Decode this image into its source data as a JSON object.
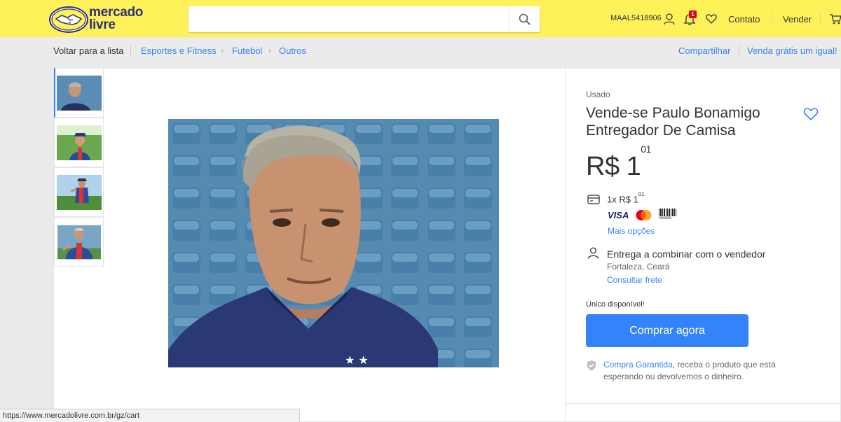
{
  "header": {
    "logo_text_line1": "mercado",
    "logo_text_line2": "livre",
    "search_placeholder": "",
    "username": "MAAL5418906",
    "notification_count": "1",
    "contact_label": "Contato",
    "sell_label": "Vender",
    "brand_color": "#fff159"
  },
  "breadcrumb": {
    "back_label": "Voltar para a lista",
    "items": [
      "Esportes e Fitness",
      "Futebol",
      "Outros"
    ],
    "share_label": "Compartilhar",
    "sell_same_label": "Venda grátis um igual!"
  },
  "product": {
    "condition": "Usado",
    "title": "Vende-se Paulo Bonamigo Entregador De Camisa",
    "price_currency": "R$",
    "price_integer": "1",
    "price_cents": "01",
    "installment_prefix": "1x R$ 1",
    "installment_cents": "01",
    "payment_methods": [
      "VISA",
      "MasterCard",
      "Boleto"
    ],
    "more_options_label": "Mais opções",
    "delivery_label": "Entrega a combinar com o vendedor",
    "location": "Fortaleza, Ceará",
    "shipping_link": "Consultar frete",
    "stock_label": "Único disponível!",
    "buy_button": "Comprar agora",
    "guarantee_link": "Compra Garantida",
    "guarantee_text": ", receba o produto que está esperando ou devolvemos o dinheiro.",
    "accent_color": "#3483fa"
  },
  "thumbnails": [
    "thumb-portrait-stadium",
    "thumb-cap-field",
    "thumb-training-field",
    "thumb-shouting-field"
  ],
  "statusbar": {
    "url": "https://www.mercadolivre.com.br/gz/cart"
  }
}
